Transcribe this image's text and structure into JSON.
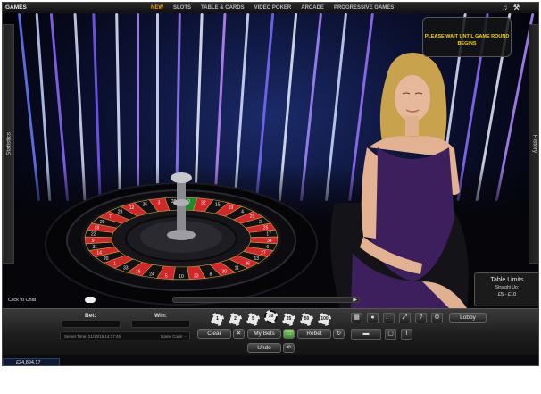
{
  "top_nav": {
    "games_label": "GAMES",
    "items": [
      "NEW",
      "SLOTS",
      "TABLE & CARDS",
      "VIDEO POKER",
      "ARCADE",
      "PROGRESSIVE GAMES"
    ],
    "active_item": "NEW",
    "icons": [
      "speaker-icon",
      "wrench-icon"
    ]
  },
  "side_tabs": {
    "left": "Statistics",
    "right": "History"
  },
  "notice": {
    "line1": "PLEASE WAIT UNTIL GAME ROUND",
    "line2": "BEGINS"
  },
  "wheel_numbers": [
    "0",
    "32",
    "15",
    "19",
    "4",
    "21",
    "2",
    "25",
    "17",
    "34",
    "6",
    "27",
    "13",
    "36",
    "11",
    "30",
    "8",
    "23",
    "10",
    "5",
    "24",
    "16",
    "33",
    "1",
    "20",
    "14",
    "31",
    "9",
    "22",
    "18",
    "29",
    "7",
    "28",
    "12",
    "35",
    "3",
    "26"
  ],
  "chat": {
    "label": "Click to Chat"
  },
  "table_limits": {
    "title": "Table Limits",
    "subtitle": "Straight Up:",
    "range": "£5 - £10"
  },
  "bet_panel": {
    "bet_label": "Bet:",
    "win_label": "Win:"
  },
  "server_info": {
    "server_time": "Server Time: 21/10/15 14:17:45",
    "game_code": "Game Code: -"
  },
  "chips": [
    "1",
    "2",
    "5",
    "10",
    "25",
    "50",
    "100"
  ],
  "buttons": {
    "clear": "Clear",
    "my_bets": "My Bets",
    "rebet": "Rebet",
    "undo": "Undo",
    "lobby": "Lobby"
  },
  "utility_icons": [
    "cards-icon",
    "chat-bubble-icon",
    "volume-icon",
    "fullscreen-icon",
    "help-icon",
    "settings-icon",
    "cash-icon",
    "info-icon"
  ],
  "balance": {
    "value": "£24,894.17"
  },
  "colors": {
    "accent": "#f2a31b",
    "notice_text": "#f2d21b",
    "dealer_dress": "#3d1f5e"
  }
}
